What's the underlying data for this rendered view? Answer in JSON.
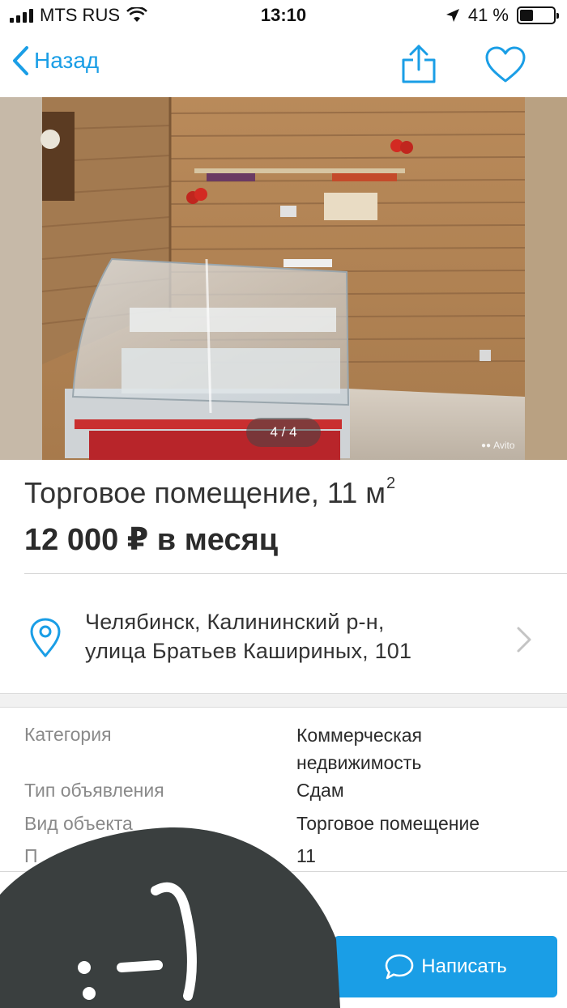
{
  "status_bar": {
    "carrier": "MTS RUS",
    "time": "13:10",
    "battery_percent": "41 %",
    "battery_level": 0.41
  },
  "nav": {
    "back_label": "Назад",
    "accent_color": "#1a9ee6"
  },
  "photo": {
    "counter": "4 / 4",
    "watermark": "Avito"
  },
  "listing": {
    "title": "Торговое помещение, 11 м",
    "title_superscript": "2",
    "price": "12 000 ₽ в месяц"
  },
  "address": {
    "line1": "Челябинск, Калининский р-н,",
    "line2": "улица Братьев Кашириных, 101"
  },
  "params": [
    {
      "label": "Категория",
      "value_line1": "Коммерческая",
      "value_line2": "недвижимость"
    },
    {
      "label": "Тип объявления",
      "value": "Сдам"
    },
    {
      "label": "Вид объекта",
      "value": "Торговое помещение"
    },
    {
      "label": "П",
      "value": "11"
    }
  ],
  "actions": {
    "write_label": "Написать"
  }
}
